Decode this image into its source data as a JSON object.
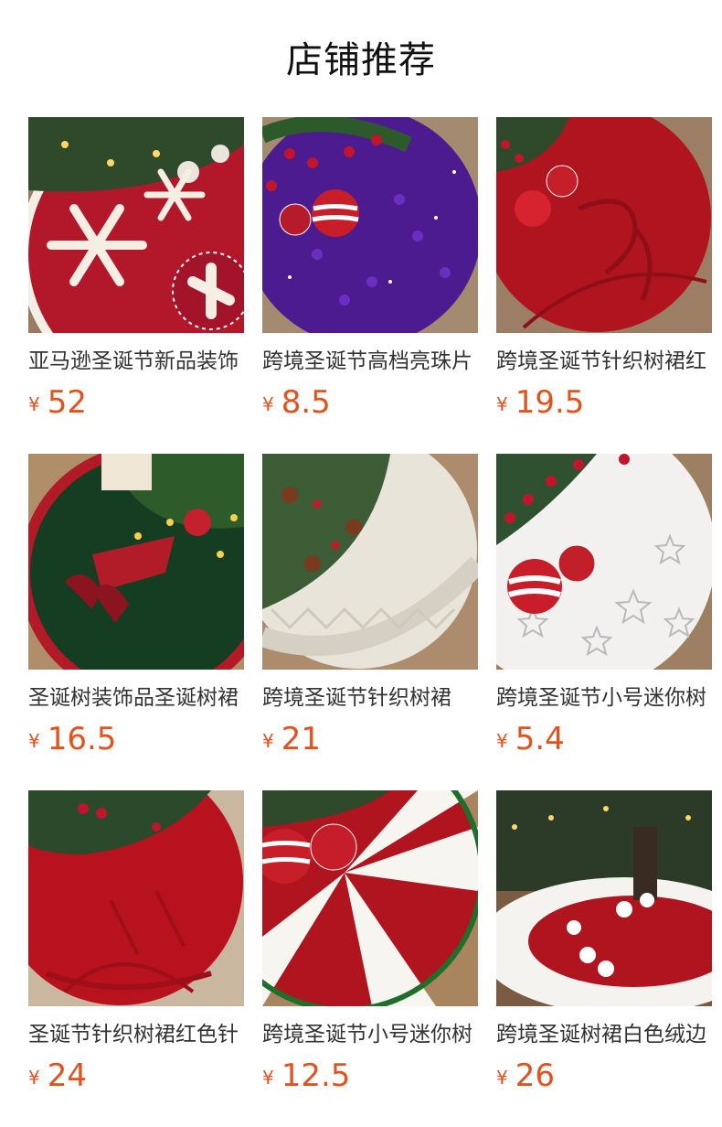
{
  "shop": {
    "title": "店铺推荐"
  },
  "currency": "¥",
  "products": [
    {
      "name": "亚马逊圣诞节新品装饰",
      "price": "52",
      "image": "red-snowflake-tree-skirt"
    },
    {
      "name": "跨境圣诞节高档亮珠片",
      "price": "8.5",
      "image": "purple-sequin-tree-skirt"
    },
    {
      "name": "跨境圣诞节针织树裙红",
      "price": "19.5",
      "image": "red-knit-tree-skirt-bow"
    },
    {
      "name": "圣诞树装饰品圣诞树裙",
      "price": "16.5",
      "image": "green-elf-tree-skirt"
    },
    {
      "name": "跨境圣诞节针织树裙",
      "price": "21",
      "image": "white-knit-tree-skirt"
    },
    {
      "name": "跨境圣诞节小号迷你树",
      "price": "5.4",
      "image": "white-star-plush-tree-skirt"
    },
    {
      "name": "圣诞节针织树裙红色针",
      "price": "24",
      "image": "red-cable-knit-tree-skirt"
    },
    {
      "name": "跨境圣诞节小号迷你树",
      "price": "12.5",
      "image": "red-white-swirl-tree-skirt"
    },
    {
      "name": "跨境圣诞树裙白色绒边",
      "price": "26",
      "image": "red-white-plush-tree-skirt"
    }
  ]
}
